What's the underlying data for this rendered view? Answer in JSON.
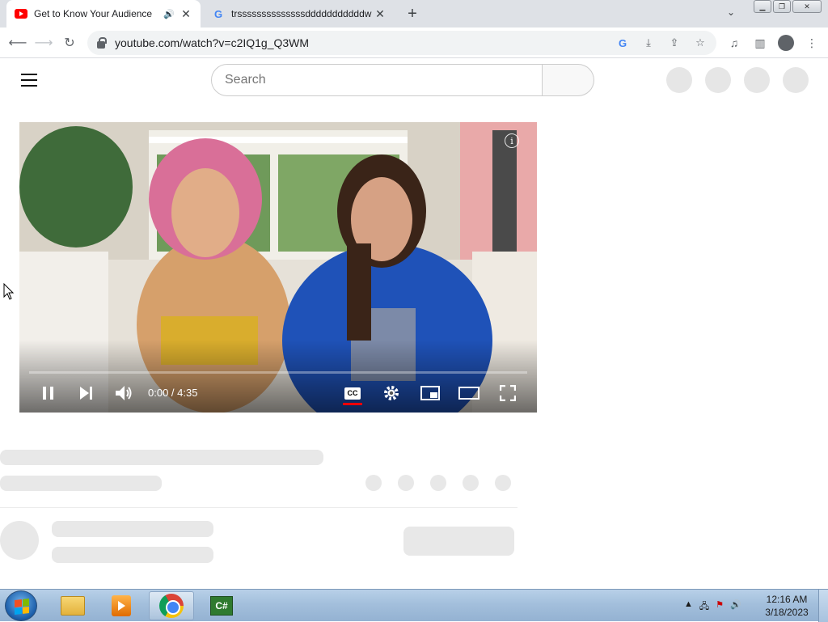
{
  "browser": {
    "tabs": [
      {
        "title": "Get to Know Your Audience",
        "favicon": "youtube-icon",
        "audio": true,
        "active": true
      },
      {
        "title": "trssssssssssssssdddddddddddw",
        "favicon": "google-icon",
        "active": false
      }
    ],
    "new_tab": "+",
    "url": "youtube.com/watch?v=c2IQ1g_Q3WM"
  },
  "youtube": {
    "search_placeholder": "Search",
    "player": {
      "time": "0:00 / 4:35",
      "cc_label": "CC",
      "info_label": "i",
      "progress": 0.0
    }
  },
  "taskbar": {
    "clock_time": "12:16 AM",
    "clock_date": "3/18/2023",
    "csharp_label": "C#"
  },
  "colors": {
    "youtube_red": "#ff0000",
    "chrome_tab_bg": "#dee1e6",
    "taskbar": "#a3bfdc"
  }
}
